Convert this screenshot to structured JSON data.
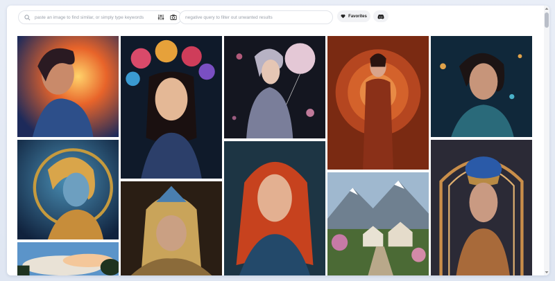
{
  "search": {
    "placeholder": "paste an image to find similar, or simply type keywords"
  },
  "negative": {
    "placeholder": "negative query to filter out unwanted results"
  },
  "favorites": {
    "label": "Favorites"
  },
  "colors": {
    "accent": "#222222",
    "field_border": "#e1e4ea",
    "pill_bg": "#f1f2f5"
  },
  "icons": [
    "search-icon",
    "sliders-icon",
    "camera-icon",
    "heart-icon",
    "discord-icon"
  ],
  "gallery": [
    "portrait-woman-flames",
    "woman-flower-crown",
    "woman-with-balloon",
    "woman-red-coat-arch",
    "woman-teal-portrait",
    "woman-blue-golden-hair",
    "woman-red-hair",
    "mountain-village",
    "woman-gold-headdress",
    "sky-clouds",
    "woman-helmet-art-deco"
  ]
}
